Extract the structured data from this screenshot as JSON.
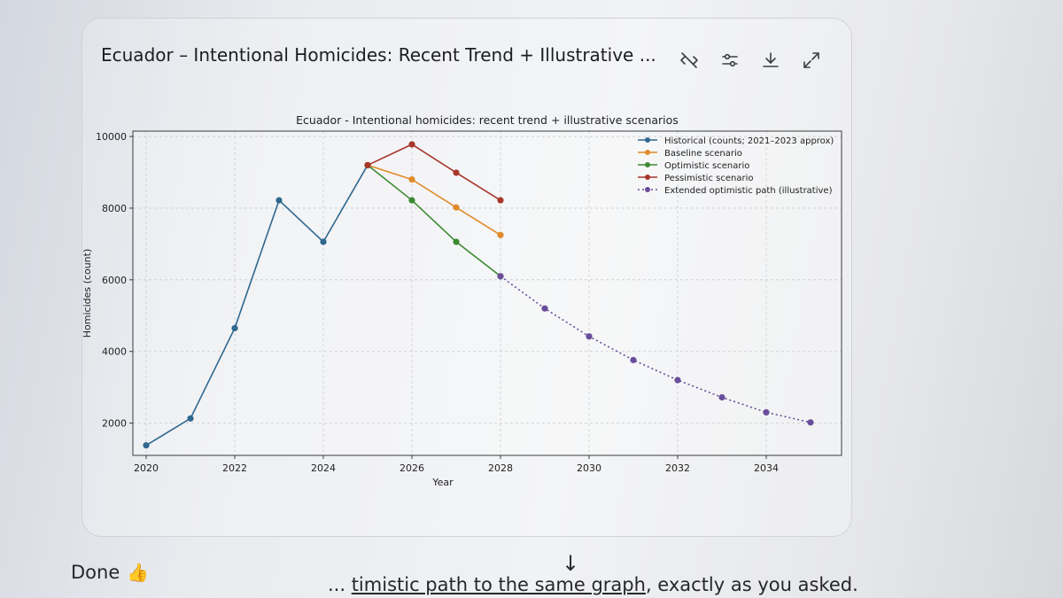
{
  "card": {
    "title": "Ecuador – Intentional Homicides: Recent Trend + Illustrative ...",
    "icons": [
      "hide-code-icon",
      "sliders-icon",
      "download-icon",
      "expand-icon"
    ]
  },
  "chart_data": {
    "type": "line",
    "title": "Ecuador - Intentional homicides: recent trend + illustrative scenarios",
    "xlabel": "Year",
    "ylabel": "Homicides (count)",
    "xlim": [
      2019.7,
      2035.7
    ],
    "ylim": [
      1100,
      10150
    ],
    "xticks": [
      2020,
      2022,
      2024,
      2026,
      2028,
      2030,
      2032,
      2034
    ],
    "yticks": [
      2000,
      4000,
      6000,
      8000,
      10000
    ],
    "grid": true,
    "legend_position": "top-right",
    "series": [
      {
        "name": "Historical (counts; 2021–2023 approx)",
        "color": "#2f6890",
        "style": "solid",
        "x": [
          2020,
          2021,
          2022,
          2023,
          2024,
          2025
        ],
        "y": [
          1380,
          2130,
          4650,
          8220,
          7060,
          9200
        ]
      },
      {
        "name": "Baseline scenario",
        "color": "#e08a2a",
        "style": "solid",
        "x": [
          2025,
          2026,
          2027,
          2028
        ],
        "y": [
          9200,
          8800,
          8020,
          7250
        ]
      },
      {
        "name": "Optimistic scenario",
        "color": "#3c8a32",
        "style": "solid",
        "x": [
          2025,
          2026,
          2027,
          2028
        ],
        "y": [
          9200,
          8220,
          7060,
          6100
        ]
      },
      {
        "name": "Pessimistic scenario",
        "color": "#a8362b",
        "style": "solid",
        "x": [
          2025,
          2026,
          2027,
          2028
        ],
        "y": [
          9200,
          9780,
          8990,
          8220
        ]
      },
      {
        "name": "Extended optimistic path (illustrative)",
        "color": "#6a4d9a",
        "style": "dotted",
        "x": [
          2028,
          2029,
          2030,
          2031,
          2032,
          2033,
          2034,
          2035
        ],
        "y": [
          6100,
          5200,
          4420,
          3760,
          3200,
          2720,
          2300,
          2020
        ]
      }
    ]
  },
  "footer": {
    "done_text": "Done",
    "done_emoji": "👍",
    "message_start": "... ",
    "message_link": "timistic path to the same graph",
    "message_end": ", exactly as you asked."
  }
}
